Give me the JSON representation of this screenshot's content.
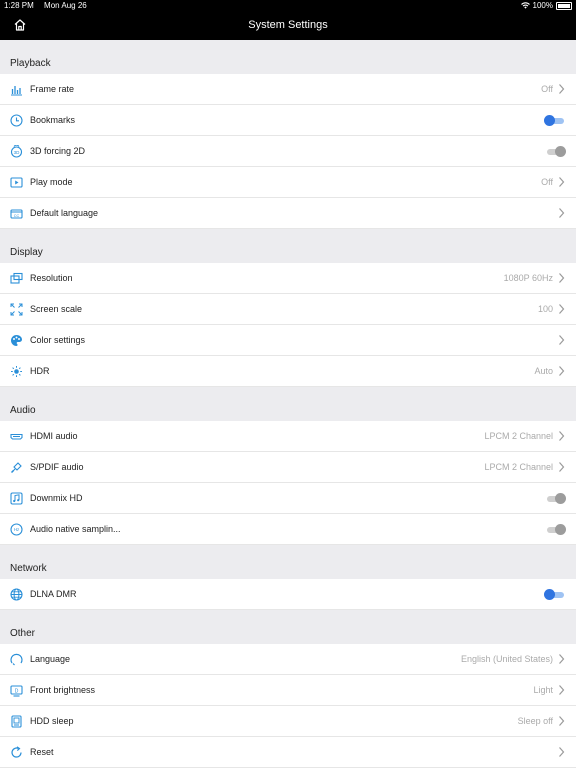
{
  "status_bar": {
    "time": "1:28 PM",
    "date": "Mon Aug 26",
    "battery": "100%"
  },
  "nav": {
    "title": "System Settings"
  },
  "colors": {
    "accent": "#2f74e0",
    "icon": "#2a8fd8"
  },
  "sections": [
    {
      "title": "Playback",
      "rows": [
        {
          "label": "Frame rate",
          "value": "Off",
          "icon": "equalizer-icon"
        },
        {
          "label": "Bookmarks",
          "toggle": "on",
          "icon": "clock-icon"
        },
        {
          "label": "3D forcing 2D",
          "toggle": "off",
          "icon": "3d-icon"
        },
        {
          "label": "Play mode",
          "value": "Off",
          "icon": "play-icon"
        },
        {
          "label": "Default language",
          "value": "",
          "icon": "subtitle-icon"
        }
      ]
    },
    {
      "title": "Display",
      "rows": [
        {
          "label": "Resolution",
          "value": "1080P  60Hz",
          "icon": "resolution-icon"
        },
        {
          "label": "Screen scale",
          "value": "100",
          "icon": "scale-icon"
        },
        {
          "label": "Color settings",
          "value": "",
          "icon": "palette-icon"
        },
        {
          "label": "HDR",
          "value": "Auto",
          "icon": "hdr-icon"
        }
      ]
    },
    {
      "title": "Audio",
      "rows": [
        {
          "label": "HDMI audio",
          "value": "LPCM 2 Channel",
          "icon": "hdmi-icon"
        },
        {
          "label": "S/PDIF audio",
          "value": "LPCM 2 Channel",
          "icon": "spdif-icon"
        },
        {
          "label": "Downmix HD",
          "toggle": "off",
          "icon": "music-icon"
        },
        {
          "label": "Audio native samplin...",
          "toggle": "off",
          "icon": "sampling-icon"
        }
      ]
    },
    {
      "title": "Network",
      "rows": [
        {
          "label": "DLNA DMR",
          "toggle": "on",
          "icon": "globe-icon"
        }
      ]
    },
    {
      "title": "Other",
      "rows": [
        {
          "label": "Language",
          "value": "English (United States)",
          "icon": "language-icon"
        },
        {
          "label": "Front brightness",
          "value": "Light",
          "icon": "brightness-icon"
        },
        {
          "label": "HDD sleep",
          "value": "Sleep off",
          "icon": "hdd-icon"
        },
        {
          "label": "Reset",
          "value": "",
          "icon": "reset-icon"
        }
      ]
    }
  ]
}
